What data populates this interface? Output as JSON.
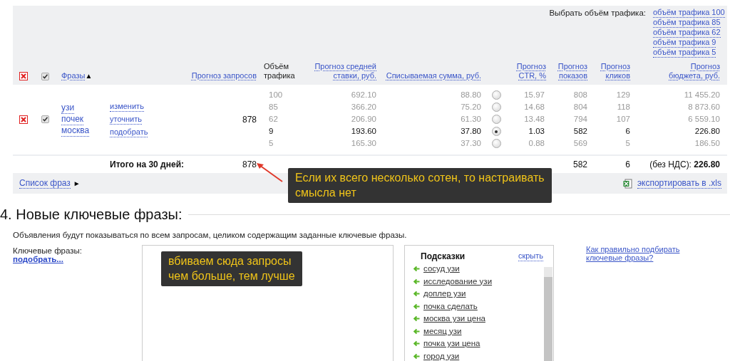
{
  "traffic_selector": {
    "label": "Выбрать объём трафика:",
    "options": [
      "объём трафика 100",
      "объём трафика 85",
      "объём трафика 62",
      "объём трафика 9",
      "объём трафика 5"
    ]
  },
  "table": {
    "header_checked": true,
    "columns": [
      {
        "label": "Фразы",
        "kind": "link",
        "sort_mark": "▲"
      },
      {
        "label": "Прогноз запросов",
        "kind": "link"
      },
      {
        "label": "Объём трафика",
        "kind": "text"
      },
      {
        "label": "Прогноз средней ставки, руб.",
        "kind": "link"
      },
      {
        "label": "Списываемая сумма, руб.",
        "kind": "link"
      },
      {
        "label": "Прогноз CTR, %",
        "kind": "link"
      },
      {
        "label": "Прогноз показов",
        "kind": "link"
      },
      {
        "label": "Прогноз кликов",
        "kind": "link"
      },
      {
        "label": "Прогноз бюджета, руб.",
        "kind": "link"
      }
    ],
    "rows": [
      {
        "checked": true,
        "phrase": [
          "узи",
          "почек",
          "москва"
        ],
        "actions": [
          "изменить",
          "уточнить",
          "подобрать"
        ],
        "requests": "878",
        "options": [
          {
            "traffic": "100",
            "bid": "692.10",
            "sum": "88.80",
            "selected": false,
            "ctr": "15.97",
            "shows": "808",
            "clicks": "129",
            "budget": "11 455.20"
          },
          {
            "traffic": "85",
            "bid": "366.20",
            "sum": "75.20",
            "selected": false,
            "ctr": "14.68",
            "shows": "804",
            "clicks": "118",
            "budget": "8 873.60"
          },
          {
            "traffic": "62",
            "bid": "206.90",
            "sum": "61.30",
            "selected": false,
            "ctr": "13.48",
            "shows": "794",
            "clicks": "107",
            "budget": "6 559.10"
          },
          {
            "traffic": "9",
            "bid": "193.60",
            "sum": "37.80",
            "selected": true,
            "ctr": "1.03",
            "shows": "582",
            "clicks": "6",
            "budget": "226.80"
          },
          {
            "traffic": "5",
            "bid": "165.30",
            "sum": "37.30",
            "selected": false,
            "ctr": "0.88",
            "shows": "569",
            "clicks": "5",
            "budget": "186.50"
          }
        ]
      }
    ],
    "totals": {
      "label": "Итого на 30 дней:",
      "requests": "878",
      "shows": "582",
      "clicks": "6",
      "budget": "(без НДС): **226.80**"
    }
  },
  "footer": {
    "phrase_list": "Список фраз",
    "toggle": "►",
    "export": "экспортировать в .xls"
  },
  "annotations": [
    {
      "kind": "arrow-note",
      "lines": [
        "Если их всего несколько сотен, то настраивать",
        "смысла нет"
      ]
    },
    {
      "kind": "note",
      "lines": [
        "вбиваем сюда запросы",
        "чем больше, тем лучше"
      ]
    }
  ],
  "section": {
    "title": "4. Новые ключевые фразы:",
    "description": "Объявления будут показываться по всем запросам, целиком содержащим заданные ключевые фразы.",
    "keywords_label": "Ключевые фразы:",
    "pick_link": "подобрать...",
    "hints": {
      "title": "Подсказки",
      "hide": "скрыть",
      "items": [
        "сосуд узи",
        "исследование узи",
        "доплер узи",
        "почка сделать",
        "москва узи цена",
        "месяц узи",
        "почка узи цена",
        "город узи"
      ]
    },
    "help_link": "Как правильно подбирать ключевые фразы?"
  }
}
